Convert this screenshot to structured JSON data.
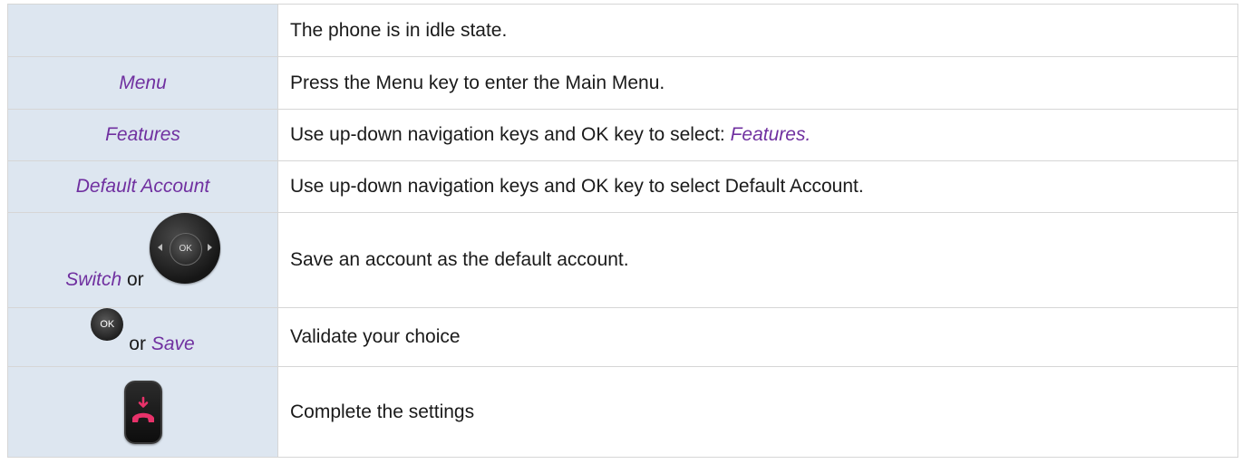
{
  "rows": [
    {
      "key": "",
      "description": "The phone is in idle state."
    },
    {
      "key": "Menu",
      "description": "Press the Menu key to enter the Main Menu."
    },
    {
      "key": "Features",
      "description_prefix": "Use up-down navigation keys and OK key to select: ",
      "description_emphasis": "Features."
    },
    {
      "key": "Default Account",
      "description": "Use up-down navigation keys and OK key to select Default Account."
    },
    {
      "key": "Switch",
      "key_connector": "or",
      "key_icon": "navigation-pad-icon",
      "key_icon_label": "OK",
      "description": "Save an account as the default account."
    },
    {
      "key_icon": "ok-button-icon",
      "key_icon_label": "OK",
      "key_connector": "or",
      "key": "Save",
      "description": "Validate your choice"
    },
    {
      "key_icon": "hang-up-key-icon",
      "description": "Complete the settings"
    }
  ],
  "colors": {
    "key_column_background": "#dde6f0",
    "emphasis_text": "#7030a0",
    "body_text": "#1a1a1a",
    "border": "#d6d6d6"
  }
}
